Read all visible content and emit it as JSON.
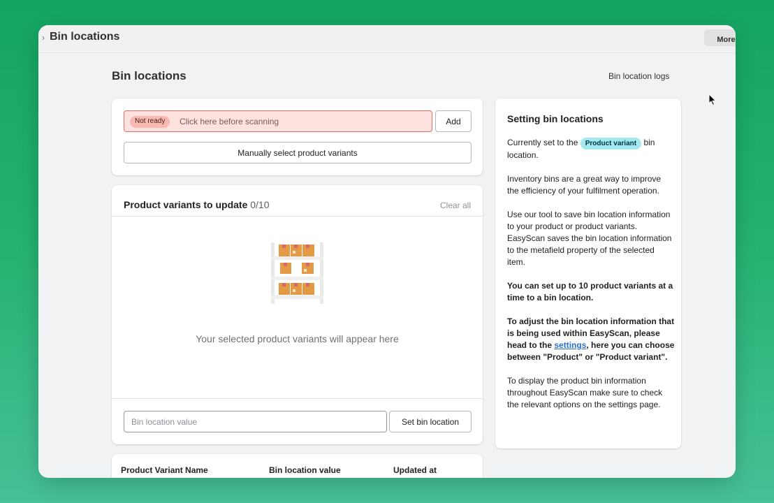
{
  "app": {
    "title": "Bin locations",
    "more_label": "More"
  },
  "header": {
    "title": "Bin locations",
    "logs_link": "Bin location logs"
  },
  "scan": {
    "status_badge": "Not ready",
    "placeholder": "Click here before scanning",
    "add_label": "Add",
    "manual_label": "Manually select product variants"
  },
  "variants": {
    "title": "Product variants to update",
    "count": "0/10",
    "clear_all": "Clear all",
    "empty_text": "Your selected product variants will appear here",
    "bin_placeholder": "Bin location value",
    "set_label": "Set bin location"
  },
  "table": {
    "columns": [
      "Product Variant Name",
      "Bin location value",
      "Updated at"
    ]
  },
  "help": {
    "title": "Setting bin locations",
    "p1_before": "Currently set to the",
    "p1_badge": "Product variant",
    "p1_after": "bin location.",
    "p2": "Inventory bins are a great way to improve the efficiency of your fulfilment operation.",
    "p3": "Use our tool to save bin location information to your product or product variants. EasyScan saves the bin location information to the metafield property of the selected item.",
    "p4": "You can set up to 10 product variants at a time to a bin location.",
    "p5_before": "To adjust the bin location information that is being used within EasyScan, please head to the",
    "p5_link": "settings",
    "p5_after": ", here you can choose between \"Product\" or \"Product variant\".",
    "p6": "To display the product bin information throughout EasyScan make sure to check the relevant options on the settings page."
  },
  "colors": {
    "accent_green": "#14a463",
    "error_bg": "#fde2df",
    "error_border": "#e46e62",
    "info_badge": "#a4e8f2",
    "link": "#2c6ecb",
    "box_orange": "#e49a45"
  }
}
